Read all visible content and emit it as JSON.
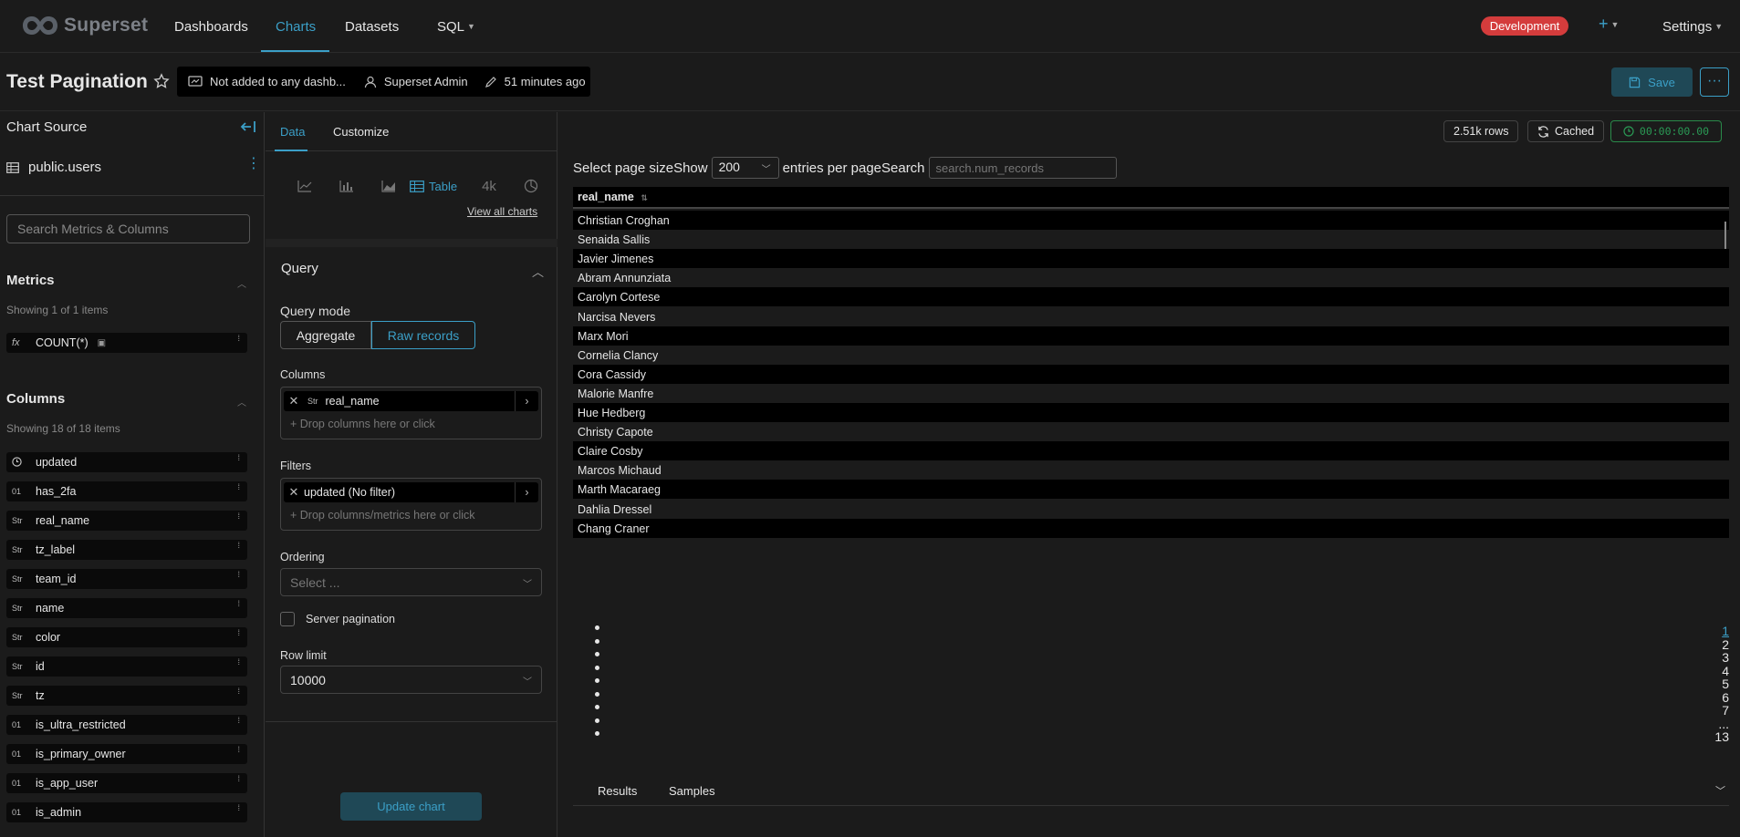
{
  "nav": {
    "brand": "Superset",
    "items": [
      "Dashboards",
      "Charts",
      "Datasets",
      "SQL"
    ],
    "env_badge": "Development",
    "settings": "Settings",
    "accent": "#3b9fc7",
    "badge_color": "#d43c3c"
  },
  "header": {
    "title": "Test Pagination",
    "dashboards": "Not added to any dashb...",
    "owner": "Superset Admin",
    "modified": "51 minutes ago",
    "save_label": "Save"
  },
  "datasource": {
    "title": "Chart Source",
    "dataset": "public.users",
    "search_placeholder": "Search Metrics & Columns",
    "metrics_title": "Metrics",
    "metrics_count": "Showing 1 of 1 items",
    "metrics": [
      {
        "type": "fx",
        "name": "COUNT(*)"
      }
    ],
    "columns_title": "Columns",
    "columns_count": "Showing 18 of 18 items",
    "columns": [
      {
        "type": "clock",
        "name": "updated"
      },
      {
        "type": "01",
        "name": "has_2fa"
      },
      {
        "type": "Str",
        "name": "real_name"
      },
      {
        "type": "Str",
        "name": "tz_label"
      },
      {
        "type": "Str",
        "name": "team_id"
      },
      {
        "type": "Str",
        "name": "name"
      },
      {
        "type": "Str",
        "name": "color"
      },
      {
        "type": "Str",
        "name": "id"
      },
      {
        "type": "Str",
        "name": "tz"
      },
      {
        "type": "01",
        "name": "is_ultra_restricted"
      },
      {
        "type": "01",
        "name": "is_primary_owner"
      },
      {
        "type": "01",
        "name": "is_app_user"
      },
      {
        "type": "01",
        "name": "is_admin"
      }
    ]
  },
  "controls": {
    "tabs": [
      "Data",
      "Customize"
    ],
    "viz_table_label": "Table",
    "viz_big_number": "4k",
    "view_all": "View all charts",
    "query_title": "Query",
    "query_mode_label": "Query mode",
    "query_modes": [
      "Aggregate",
      "Raw records"
    ],
    "columns_label": "Columns",
    "column_chip": "real_name",
    "column_type": "Str",
    "columns_drop": "Drop columns here or click",
    "filters_label": "Filters",
    "filter_chip": "updated (No filter)",
    "filters_drop": "Drop columns/metrics here or click",
    "ordering_label": "Ordering",
    "ordering_placeholder": "Select ...",
    "server_pagination": "Server pagination",
    "row_limit_label": "Row limit",
    "row_limit": "10000",
    "update_label": "Update chart"
  },
  "results": {
    "rows_badge": "2.51k rows",
    "cached": "Cached",
    "timer": "00:00:00.00",
    "page_size_prefix": "Select page sizeShow",
    "page_size": "200",
    "page_size_suffix": "entries per pageSearch",
    "search_placeholder": "search.num_records",
    "column_header": "real_name",
    "rows": [
      "Christian Croghan",
      "Senaida Sallis",
      "Javier Jimenes",
      "Abram Annunziata",
      "Carolyn Cortese",
      "Narcisa Nevers",
      "Marx Mori",
      "Cornelia Clancy",
      "Cora Cassidy",
      "Malorie Manfre",
      "Hue Hedberg",
      "Christy Capote",
      "Claire Cosby",
      "Marcos Michaud",
      "Marth Macaraeg",
      "Dahlia Dressel",
      "Chang Craner"
    ],
    "pages": [
      "1",
      "2",
      "3",
      "4",
      "5",
      "6",
      "7",
      "...",
      "13"
    ],
    "bottom_tabs": [
      "Results",
      "Samples"
    ]
  }
}
